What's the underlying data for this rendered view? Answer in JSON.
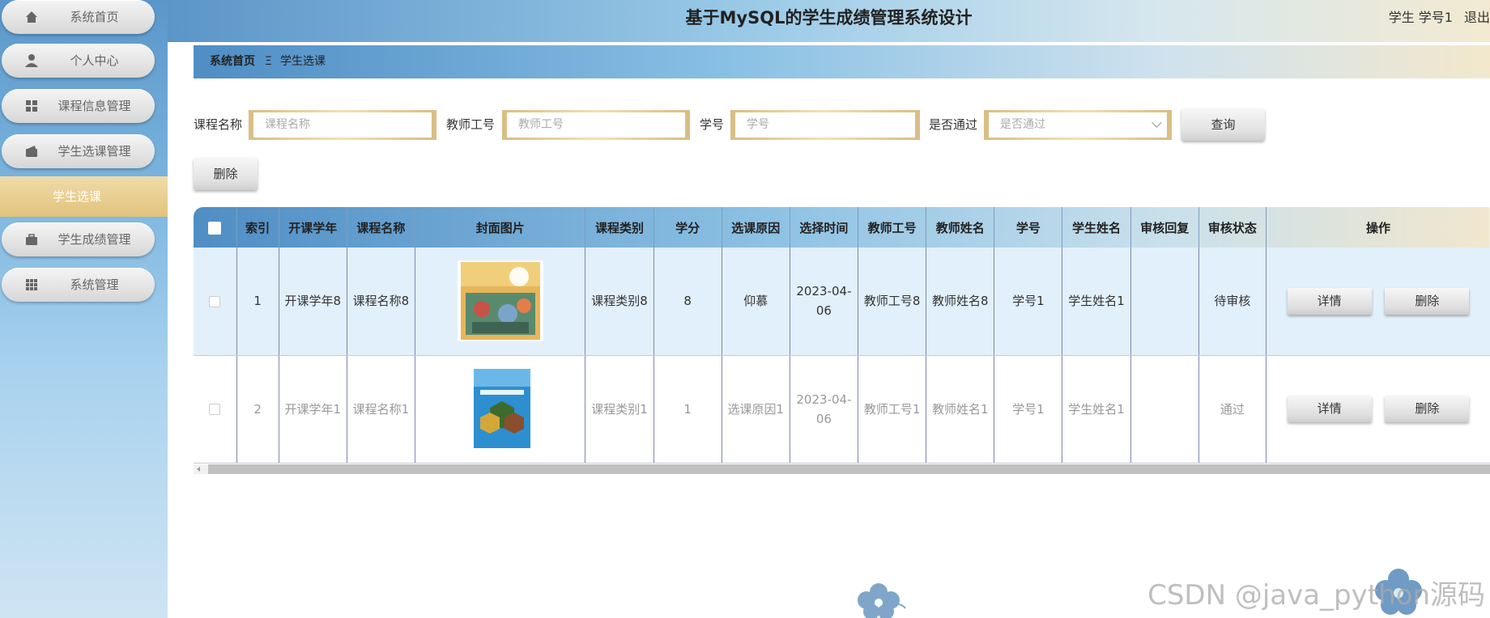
{
  "header": {
    "title": "基于MySQL的学生成绩管理系统设计",
    "user": "学生 学号1",
    "logout": "退出"
  },
  "sidebar": {
    "items": [
      {
        "label": "系统首页",
        "icon": "home-icon"
      },
      {
        "label": "个人中心",
        "icon": "user-icon"
      },
      {
        "label": "课程信息管理",
        "icon": "grid-icon"
      },
      {
        "label": "学生选课管理",
        "icon": "wallet-icon"
      },
      {
        "label": "学生成绩管理",
        "icon": "briefcase-icon"
      },
      {
        "label": "系统管理",
        "icon": "apps-icon"
      }
    ],
    "active_sub": "学生选课"
  },
  "breadcrumb": {
    "home": "系统首页",
    "separator": "Ξ",
    "current": "学生选课"
  },
  "search": {
    "course_name": {
      "label": "课程名称",
      "placeholder": "课程名称"
    },
    "teacher_id": {
      "label": "教师工号",
      "placeholder": "教师工号"
    },
    "student_id": {
      "label": "学号",
      "placeholder": "学号"
    },
    "passed": {
      "label": "是否通过",
      "placeholder": "是否通过"
    },
    "query_button": "查询",
    "delete_button": "删除"
  },
  "table": {
    "headers": [
      "索引",
      "开课学年",
      "课程名称",
      "封面图片",
      "课程类别",
      "学分",
      "选课原因",
      "选择时间",
      "教师工号",
      "教师姓名",
      "学号",
      "学生姓名",
      "审核回复",
      "审核状态",
      "操作"
    ],
    "rows": [
      {
        "index": "1",
        "year": "开课学年8",
        "course": "课程名称8",
        "category": "课程类别8",
        "credit": "8",
        "reason": "仰慕",
        "time": "2023-04-06",
        "teacher_id": "教师工号8",
        "teacher_name": "教师姓名8",
        "student_id": "学号1",
        "student_name": "学生姓名1",
        "reply": "",
        "status": "待审核"
      },
      {
        "index": "2",
        "year": "开课学年1",
        "course": "课程名称1",
        "category": "课程类别1",
        "credit": "1",
        "reason": "选课原因1",
        "time": "2023-04-06",
        "teacher_id": "教师工号1",
        "teacher_name": "教师姓名1",
        "student_id": "学号1",
        "student_name": "学生姓名1",
        "reply": "",
        "status": "通过"
      }
    ],
    "detail_button": "详情",
    "delete_button": "删除"
  },
  "watermark": "CSDN @java_python源码",
  "colors": {
    "accent_blue": "#5b95c8",
    "accent_gold": "#e2c27c"
  }
}
